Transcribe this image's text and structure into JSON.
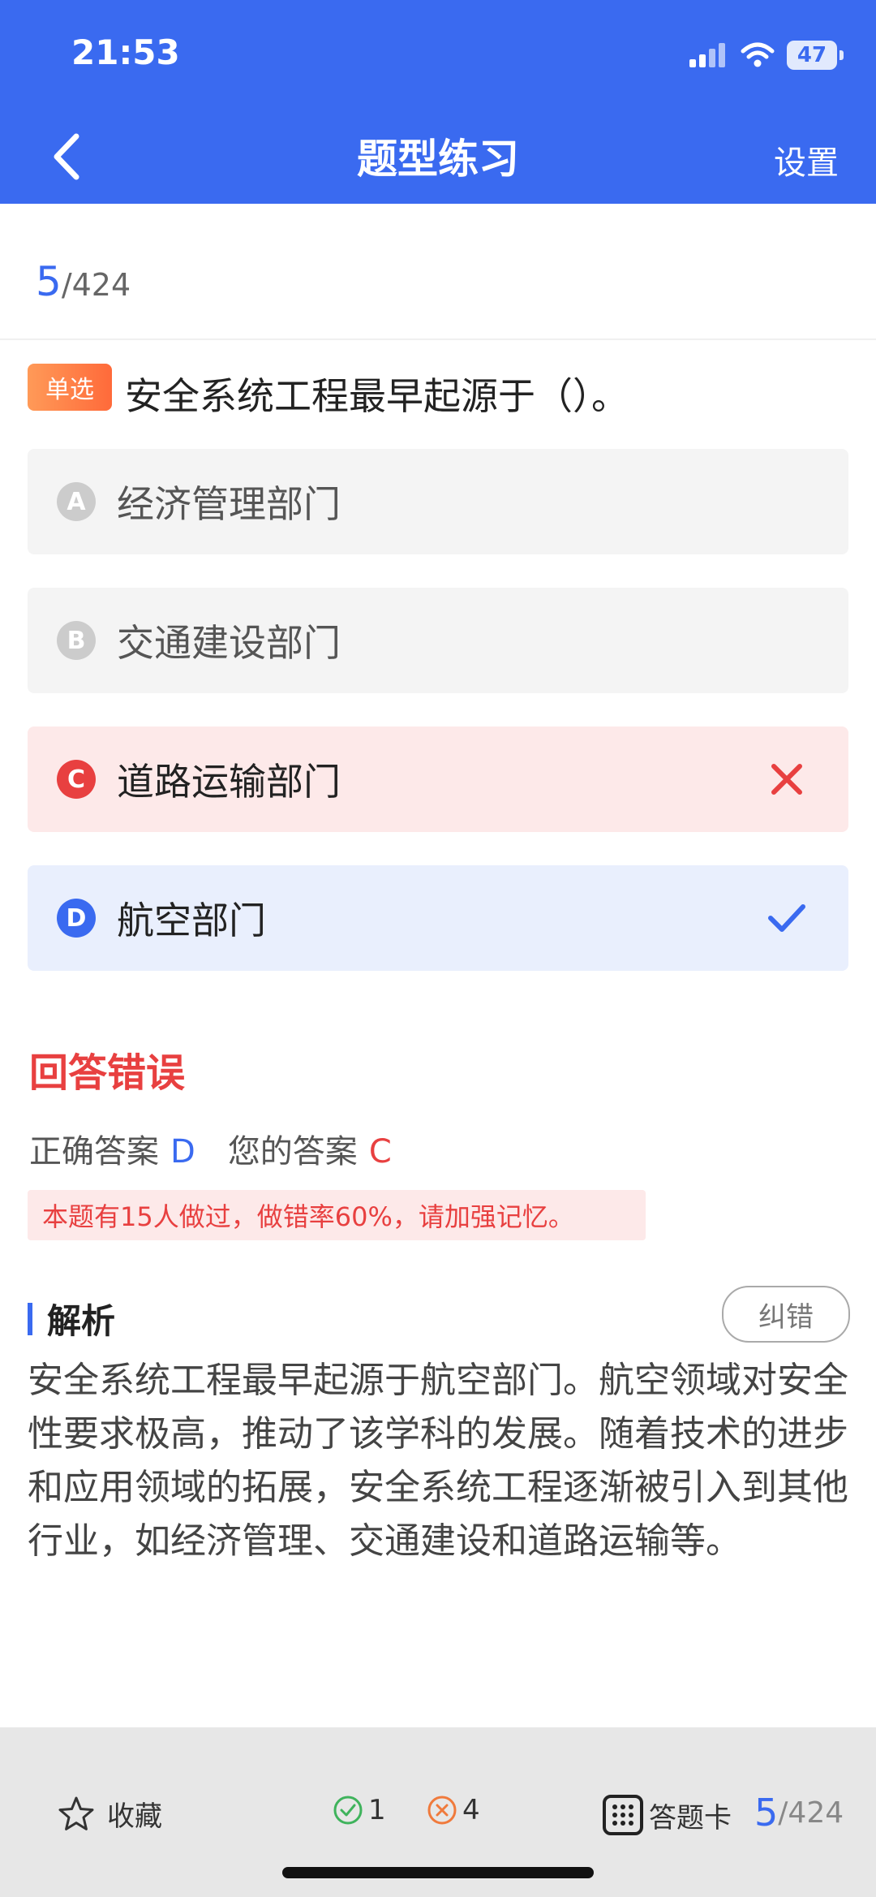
{
  "status_bar": {
    "time": "21:53",
    "battery": "47"
  },
  "nav": {
    "title": "题型练习",
    "settings_label": "设置"
  },
  "progress": {
    "current": "5",
    "total": "/424"
  },
  "question": {
    "type_label": "单选",
    "text": "安全系统工程最早起源于（）。",
    "options": [
      {
        "letter": "A",
        "text": "经济管理部门",
        "state": "normal"
      },
      {
        "letter": "B",
        "text": "交通建设部门",
        "state": "normal"
      },
      {
        "letter": "C",
        "text": "道路运输部门",
        "state": "wrong"
      },
      {
        "letter": "D",
        "text": "航空部门",
        "state": "correct"
      }
    ]
  },
  "result": {
    "title": "回答错误",
    "correct_label": "正确答案",
    "correct_value": "D",
    "yours_label": "您的答案",
    "yours_value": "C",
    "stat_text": "本题有15人做过，做错率60%，请加强记忆。"
  },
  "analysis": {
    "title": "解析",
    "report_label": "纠错",
    "body": "安全系统工程最早起源于航空部门。航空领域对安全性要求极高，推动了该学科的发展。随着技术的进步和应用领域的拓展，安全系统工程逐渐被引入到其他行业，如经济管理、交通建设和道路运输等。"
  },
  "bottom_bar": {
    "favorite_label": "收藏",
    "correct_count": "1",
    "wrong_count": "4",
    "answer_card_label": "答题卡",
    "page_current": "5",
    "page_total": "/424"
  },
  "colors": {
    "primary": "#3a6af0",
    "error": "#e84040",
    "correct_bg": "#e9effd",
    "wrong_bg": "#fde9e9",
    "normal_bg": "#f4f4f4"
  }
}
